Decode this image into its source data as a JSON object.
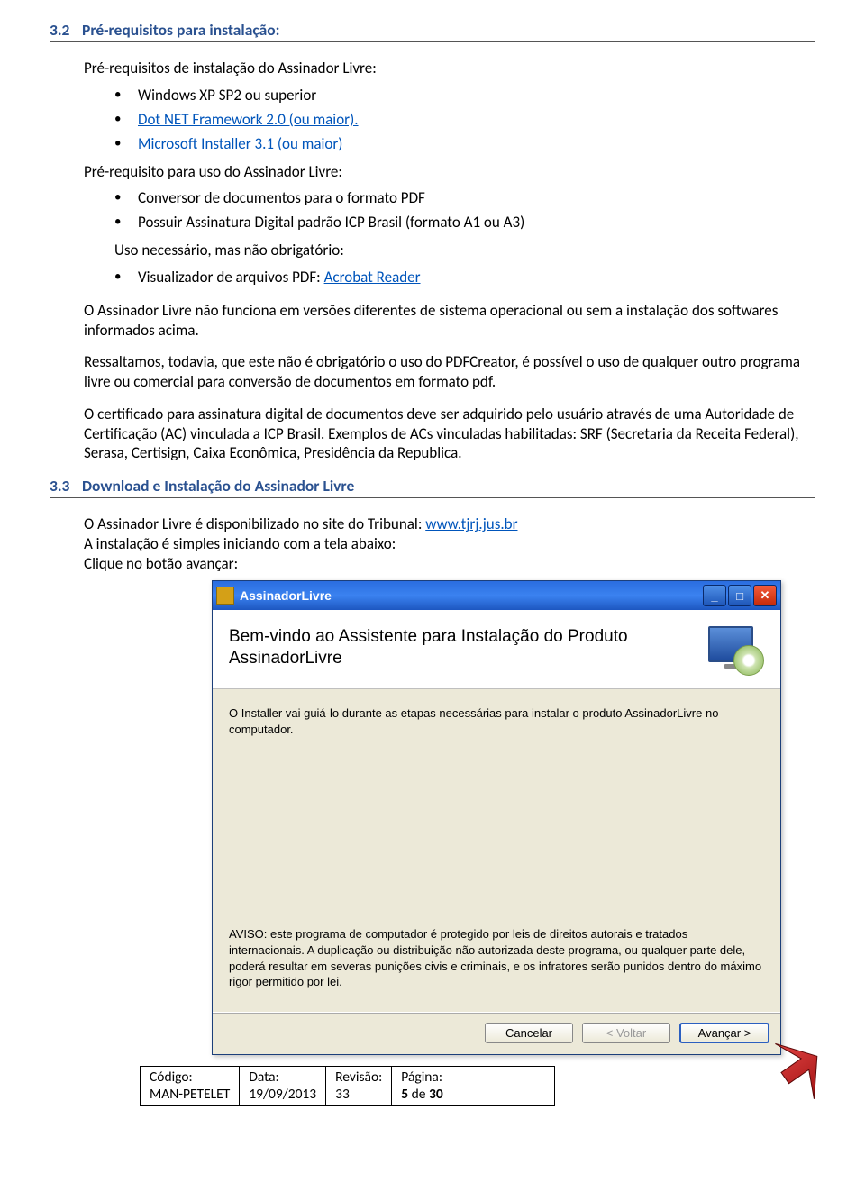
{
  "h1": {
    "num": "3.2",
    "text": "Pré-requisitos para instalação:"
  },
  "intro1": "Pré-requisitos de instalação do Assinador Livre:",
  "bullets1": {
    "b0": "Windows XP SP2 ou superior",
    "b1a": "Dot NET Framework 2.0 (ou maior).",
    "b2a": "Microsoft Installer 3.1 (ou maior)"
  },
  "intro2": "Pré-requisito para uso do Assinador Livre:",
  "bullets2": {
    "b0": "Conversor de documentos para o formato PDF",
    "b1": "Possuir Assinatura Digital padrão ICP Brasil (formato A1 ou A3)"
  },
  "intro3": "Uso necessário, mas não obrigatório:",
  "bullets3": {
    "b0a": "Visualizador de arquivos PDF: ",
    "b0b": "Acrobat Reader"
  },
  "p1": "O Assinador Livre não funciona em versões diferentes de sistema operacional ou sem a instalação dos softwares informados acima.",
  "p2": "Ressaltamos, todavia, que este não é obrigatório o uso do PDFCreator, é possível o uso de qualquer outro programa livre ou comercial para conversão de documentos em formato pdf.",
  "p3": "O certificado para assinatura digital de documentos deve ser adquirido pelo usuário através de uma Autoridade de Certificação (AC) vinculada a ICP Brasil. Exemplos de ACs vinculadas habilitadas: SRF (Secretaria da Receita Federal), Serasa, Certisign, Caixa Econômica, Presidência da Republica.",
  "h2": {
    "num": "3.3",
    "text": "Download e Instalação do Assinador Livre"
  },
  "p4a": "O Assinador Livre é disponibilizado no site do Tribunal: ",
  "p4link": "www.tjrj.jus.br",
  "p5": "A instalação é simples iniciando com a tela abaixo:",
  "p6": "Clique no botão avançar:",
  "installer": {
    "title": "AssinadorLivre",
    "banner": "Bem-vindo ao Assistente para Instalação do Produto AssinadorLivre",
    "desc": "O Installer vai guiá-lo durante as etapas necessárias para instalar o produto AssinadorLivre no computador.",
    "aviso": "AVISO: este programa de computador é protegido por leis de direitos autorais e tratados internacionais. A duplicação ou distribuição não autorizada deste programa, ou qualquer parte dele, poderá resultar em severas punições civis e criminais, e os infratores serão punidos dentro do máximo rigor permitido por lei.",
    "btn_cancel": "Cancelar",
    "btn_back": "< Voltar",
    "btn_next": "Avançar >"
  },
  "footer": {
    "l1": "Código:",
    "v1": "MAN-PETELET",
    "l2": "Data:",
    "v2": "19/09/2013",
    "l3": "Revisão:",
    "v3": "33",
    "l4": "Página:",
    "v4a": "5",
    "v4b": " de ",
    "v4c": "30"
  }
}
